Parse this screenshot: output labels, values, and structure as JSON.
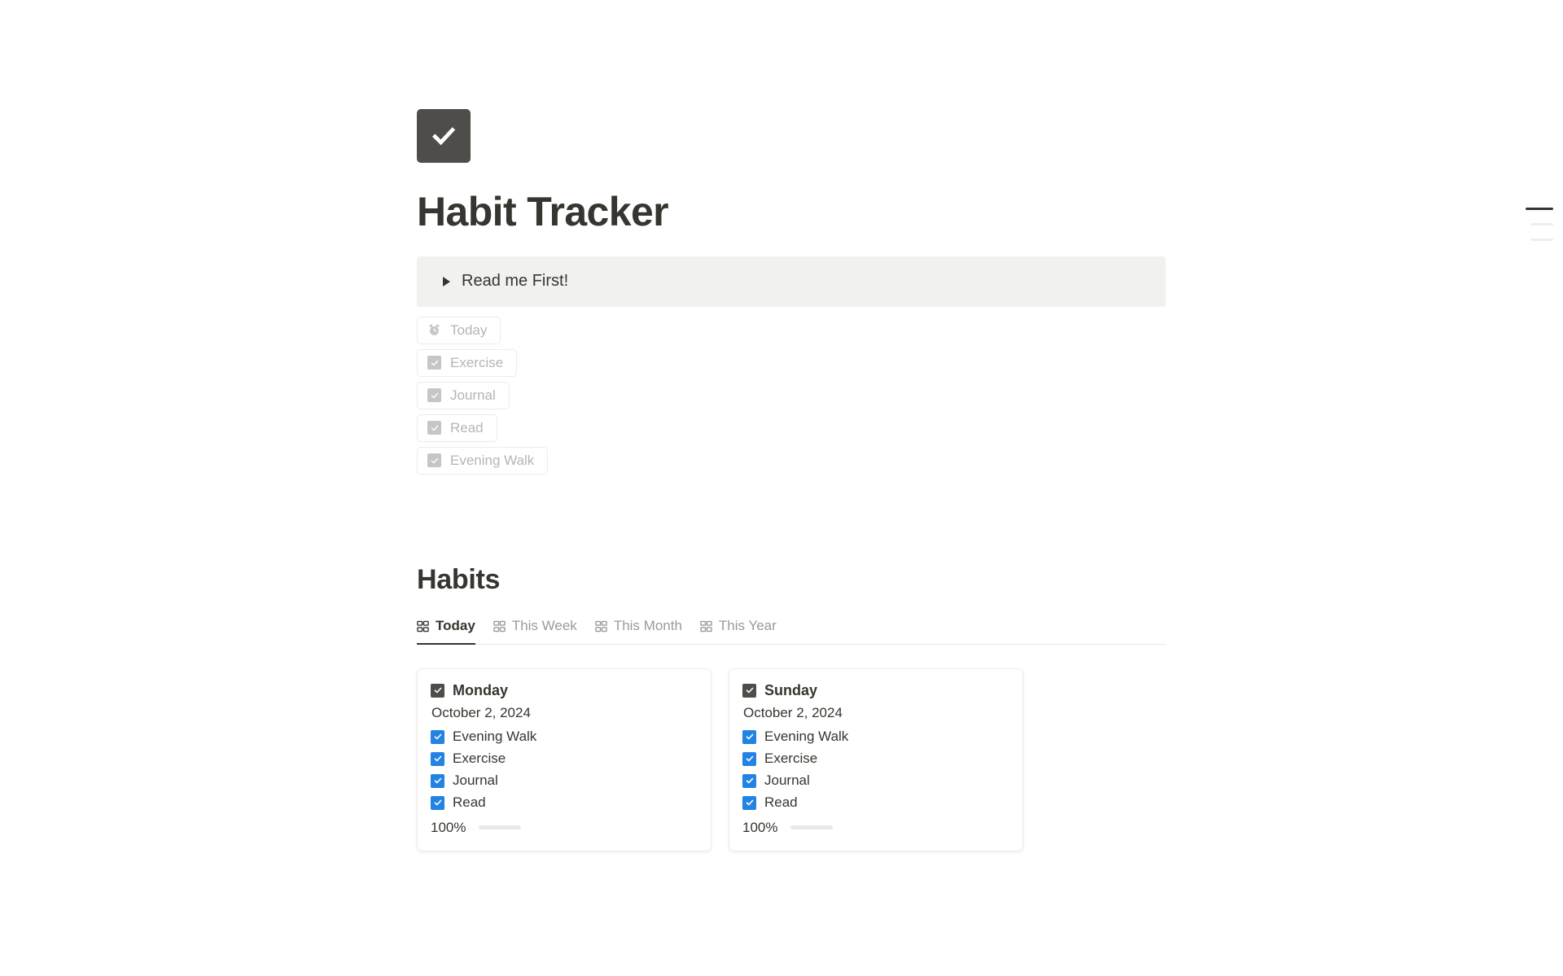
{
  "page": {
    "icon": "checkmark-icon",
    "title": "Habit Tracker"
  },
  "callout": {
    "label": "Read me First!",
    "icon": "toggle-triangle-icon",
    "collapsed": true,
    "background": "#f1f1ef"
  },
  "chips": [
    {
      "label": "Today",
      "icon": "alarm-clock-icon"
    },
    {
      "label": "Exercise",
      "icon": "checkbox-icon"
    },
    {
      "label": "Journal",
      "icon": "checkbox-icon"
    },
    {
      "label": "Read",
      "icon": "checkbox-icon"
    },
    {
      "label": "Evening Walk",
      "icon": "checkbox-icon"
    }
  ],
  "habits_section": {
    "title": "Habits",
    "tabs": [
      {
        "label": "Today",
        "icon": "gallery-grid-icon",
        "active": true
      },
      {
        "label": "This Week",
        "icon": "gallery-grid-icon",
        "active": false
      },
      {
        "label": "This Month",
        "icon": "gallery-grid-icon",
        "active": false
      },
      {
        "label": "This Year",
        "icon": "gallery-grid-icon",
        "active": false
      }
    ],
    "cards": [
      {
        "title": "Monday",
        "title_checkbox": "checked",
        "date": "October 2, 2024",
        "habits": [
          {
            "label": "Evening Walk",
            "checked": true
          },
          {
            "label": "Exercise",
            "checked": true
          },
          {
            "label": "Journal",
            "checked": true
          },
          {
            "label": "Read",
            "checked": true
          }
        ],
        "progress_label": "100%",
        "progress_value": 100
      },
      {
        "title": "Sunday",
        "title_checkbox": "checked",
        "date": "October 2, 2024",
        "habits": [
          {
            "label": "Evening Walk",
            "checked": true
          },
          {
            "label": "Exercise",
            "checked": true
          },
          {
            "label": "Journal",
            "checked": true
          },
          {
            "label": "Read",
            "checked": true
          }
        ],
        "progress_label": "100%",
        "progress_value": 100
      }
    ]
  },
  "outline": {
    "items": [
      {
        "active": true
      },
      {
        "active": false
      },
      {
        "active": false
      }
    ]
  },
  "colors": {
    "accent_blue": "#2383e2",
    "progress_green": "#7d9e83",
    "text_primary": "#37352f",
    "text_muted": "#9b9a97",
    "icon_dark": "#4f4d49",
    "callout_bg": "#f1f1ef"
  }
}
